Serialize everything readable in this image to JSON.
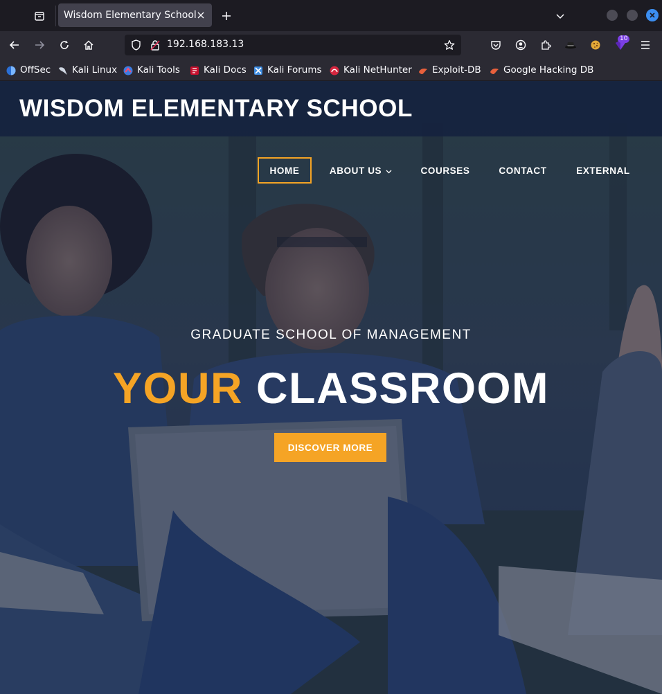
{
  "browser": {
    "tab": {
      "title": "Wisdom Elementary School"
    },
    "address": {
      "url": "192.168.183.13"
    },
    "extensions_badge": "10",
    "bookmarks": [
      {
        "label": "OffSec",
        "icon": "offsec-icon"
      },
      {
        "label": "Kali Linux",
        "icon": "kali-dragon-icon"
      },
      {
        "label": "Kali Tools",
        "icon": "kali-tools-icon"
      },
      {
        "label": "Kali Docs",
        "icon": "kali-docs-icon"
      },
      {
        "label": "Kali Forums",
        "icon": "kali-forums-icon"
      },
      {
        "label": "Kali NetHunter",
        "icon": "nethunter-icon"
      },
      {
        "label": "Exploit-DB",
        "icon": "exploit-db-icon"
      },
      {
        "label": "Google Hacking DB",
        "icon": "ghdb-icon"
      }
    ]
  },
  "site": {
    "title": "WISDOM ELEMENTARY SCHOOL",
    "menu": [
      {
        "label": "HOME",
        "active": true
      },
      {
        "label": "ABOUT US",
        "has_dropdown": true
      },
      {
        "label": "COURSES"
      },
      {
        "label": "CONTACT"
      },
      {
        "label": "EXTERNAL"
      }
    ],
    "hero": {
      "subtitle": "GRADUATE SCHOOL OF MANAGEMENT",
      "title_accent": "YOUR",
      "title_rest": "CLASSROOM",
      "cta_label": "DISCOVER MORE"
    }
  },
  "colors": {
    "accent": "#f5a425",
    "header_bg": "#15223e",
    "browser_chrome": "#2b2a33",
    "tab_strip": "#1c1b22"
  }
}
